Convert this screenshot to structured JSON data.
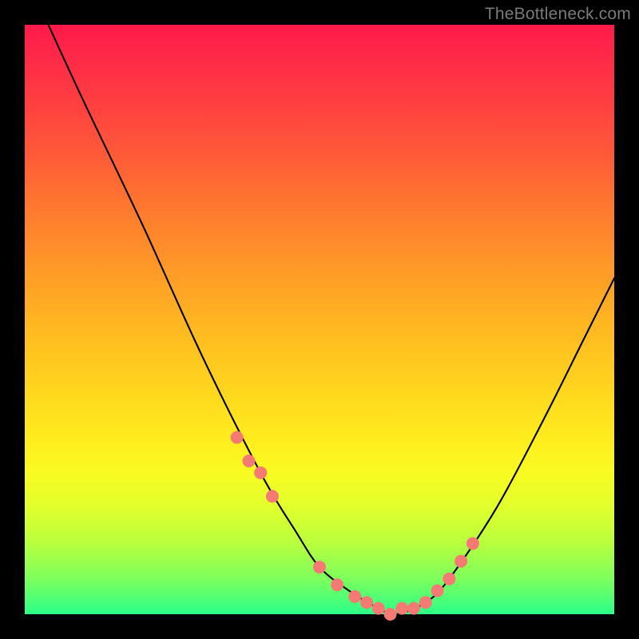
{
  "watermark": "TheBottleneck.com",
  "chart_data": {
    "type": "line",
    "title": "",
    "xlabel": "",
    "ylabel": "",
    "xlim": [
      0,
      100
    ],
    "ylim": [
      0,
      100
    ],
    "series": [
      {
        "name": "bottleneck-curve",
        "x": [
          4,
          10,
          20,
          30,
          40,
          46,
          50,
          55,
          60,
          63,
          68,
          72,
          80,
          88,
          95,
          100
        ],
        "values": [
          100,
          87,
          66,
          44,
          24,
          14,
          8,
          4,
          1,
          0,
          2,
          6,
          18,
          33,
          47,
          57
        ]
      }
    ],
    "markers": {
      "name": "highlighted-points",
      "color": "#f47a73",
      "approx_radius_px": 8,
      "x": [
        36,
        38,
        40,
        42,
        50,
        53,
        56,
        58,
        60,
        62,
        64,
        66,
        68,
        70,
        72,
        74,
        76
      ],
      "values": [
        30,
        26,
        24,
        20,
        8,
        5,
        3,
        2,
        1,
        0,
        1,
        1,
        2,
        4,
        6,
        9,
        12
      ]
    },
    "gradient_stops": [
      {
        "pct": 0,
        "color": "#ff1a4a"
      },
      {
        "pct": 50,
        "color": "#ffc020"
      },
      {
        "pct": 100,
        "color": "#2bff8a"
      }
    ]
  }
}
